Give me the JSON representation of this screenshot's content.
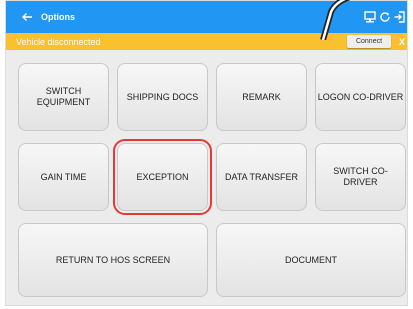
{
  "appbar": {
    "title": "Options",
    "back_icon": "arrow-left-icon",
    "icons": [
      "monitor-icon",
      "refresh-icon",
      "exit-icon"
    ],
    "color": "#2196f3"
  },
  "banner": {
    "text": "Vehicle disconnected",
    "connect_label": "Connect",
    "dismiss_label": "X",
    "color": "#fbc02d"
  },
  "menu": {
    "tiles": [
      "SWITCH\nEQUIPMENT",
      "SHIPPING DOCS",
      "REMARK",
      "LOGON CO-DRIVER",
      "GAIN TIME",
      "EXCEPTION",
      "DATA TRANSFER",
      "SWITCH CO-\nDRIVER",
      "RETURN TO HOS SCREEN",
      "DOCUMENT"
    ],
    "selected": "EXCEPTION",
    "highlight_color": "#e53935"
  }
}
